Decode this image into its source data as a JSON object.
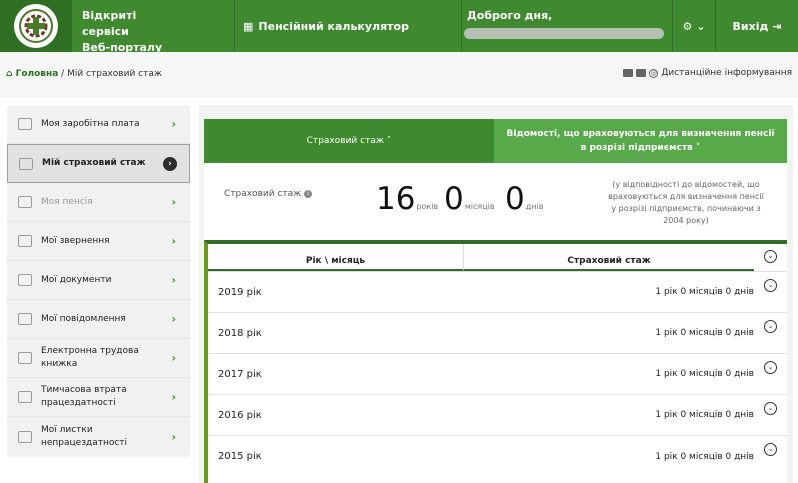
{
  "header": {
    "brand_line1": "Відкриті сервіси",
    "brand_line2": "Веб-порталу",
    "calculator_label": "Пенсійний калькулятор",
    "greeting": "Доброго дня,",
    "settings_caret": "⌄",
    "logout_label": "Вихід"
  },
  "breadcrumb": {
    "home": "Головна",
    "separator": "/",
    "current": "Мій страховий стаж"
  },
  "remote_link": "Дистанційне інформування",
  "sidebar": {
    "items": [
      {
        "label": "Моя заробітна плата",
        "state": "normal"
      },
      {
        "label": "Мій страховий стаж",
        "state": "active"
      },
      {
        "label": "Моя пенсія",
        "state": "dim"
      },
      {
        "label": "Мої звернення",
        "state": "normal"
      },
      {
        "label": "Мої документи",
        "state": "normal"
      },
      {
        "label": "Мої повідомлення",
        "state": "normal"
      },
      {
        "label": "Електронна трудова книжка",
        "state": "normal"
      },
      {
        "label": "Тимчасова втрата працездатності",
        "state": "normal"
      },
      {
        "label": "Мої листки непрацездатності",
        "state": "normal"
      }
    ]
  },
  "tabs": {
    "tab1": "Страховий стаж ˄",
    "tab2": "Відомості, що враховуються для визначення пенсії в розрізі підприємств ˅"
  },
  "summary": {
    "label": "Страховий стаж",
    "years_value": "16",
    "years_unit": "років",
    "months_value": "0",
    "months_unit": "місяців",
    "days_value": "0",
    "days_unit": "днів",
    "note": "(у відповідності до відомостей, що враховуються для визначення пенсії у розрізі підприємств, починаючи з 2004 року)"
  },
  "table": {
    "col_year": "Рік \\ місяць",
    "col_stazh": "Страховий стаж",
    "rows": [
      {
        "year": "2019 рік",
        "stazh": "1 рік 0 місяців 0 днів"
      },
      {
        "year": "2018 рік",
        "stazh": "1 рік 0 місяців 0 днів"
      },
      {
        "year": "2017 рік",
        "stazh": "1 рік 0 місяців 0 днів"
      },
      {
        "year": "2016 рік",
        "stazh": "1 рік 0 місяців 0 днів"
      },
      {
        "year": "2015 рік",
        "stazh": "1 рік 0 місяців 0 днів"
      }
    ]
  },
  "colors": {
    "brand_green": "#3f8a2f",
    "dark_green": "#2f6f24",
    "light_green": "#58a94a"
  }
}
